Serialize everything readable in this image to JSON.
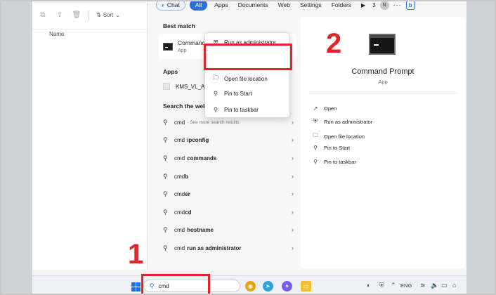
{
  "explorer": {
    "toolbar_icons": [
      "copy-icon",
      "share-icon",
      "delete-icon"
    ],
    "sort_label": "Sort",
    "column_header": "Name"
  },
  "filters": {
    "chat": "Chat",
    "all": "All",
    "apps": "Apps",
    "documents": "Documents",
    "web": "Web",
    "settings": "Settings",
    "folders": "Folders",
    "play_symbol": "▶",
    "count": "3",
    "avatar_initial": "N",
    "more": "···",
    "bing": "b"
  },
  "results": {
    "best_match_title": "Best match",
    "best_match": {
      "name": "Command Prompt",
      "sub": "App"
    },
    "apps_title": "Apps",
    "app_item": "KMS_VL_ALL_AIO_v45.",
    "web_title": "Search the web",
    "web_items": [
      {
        "query": "cmd",
        "suffix": "",
        "more": "- See more search results"
      },
      {
        "query": "cmd",
        "suffix": "ipconfig",
        "more": ""
      },
      {
        "query": "cmd",
        "suffix": "commands",
        "more": ""
      },
      {
        "query": "cmd",
        "suffix": "b",
        "more": ""
      },
      {
        "query": "cmd",
        "suffix": "er",
        "more": ""
      },
      {
        "query": "cmd",
        "suffix": "cd",
        "more": ""
      },
      {
        "query": "cmd",
        "suffix": "hostname",
        "more": ""
      },
      {
        "query": "cmd",
        "suffix": "run as administrator",
        "more": ""
      }
    ]
  },
  "context_menu": [
    {
      "label": "Run as administrator",
      "icon": "shield-icon"
    },
    {
      "label": "Open file location",
      "icon": "folder-icon"
    },
    {
      "label": "Pin to Start",
      "icon": "pin-icon"
    },
    {
      "label": "Pin to taskbar",
      "icon": "pin-icon"
    }
  ],
  "detail": {
    "title": "Command Prompt",
    "sub": "App",
    "actions": [
      {
        "label": "Open",
        "icon": "open-icon"
      },
      {
        "label": "Run as administrator",
        "icon": "shield-icon"
      },
      {
        "label": "Open file location",
        "icon": "folder-icon"
      },
      {
        "label": "Pin to Start",
        "icon": "pin-icon"
      },
      {
        "label": "Pin to taskbar",
        "icon": "pin-icon"
      }
    ]
  },
  "annotations": {
    "step1": "1",
    "step2": "2"
  },
  "taskbar": {
    "search_value": "cmd",
    "language": "ENG"
  },
  "colors": {
    "accent": "#2f6fdd",
    "highlight": "#e0242a"
  }
}
